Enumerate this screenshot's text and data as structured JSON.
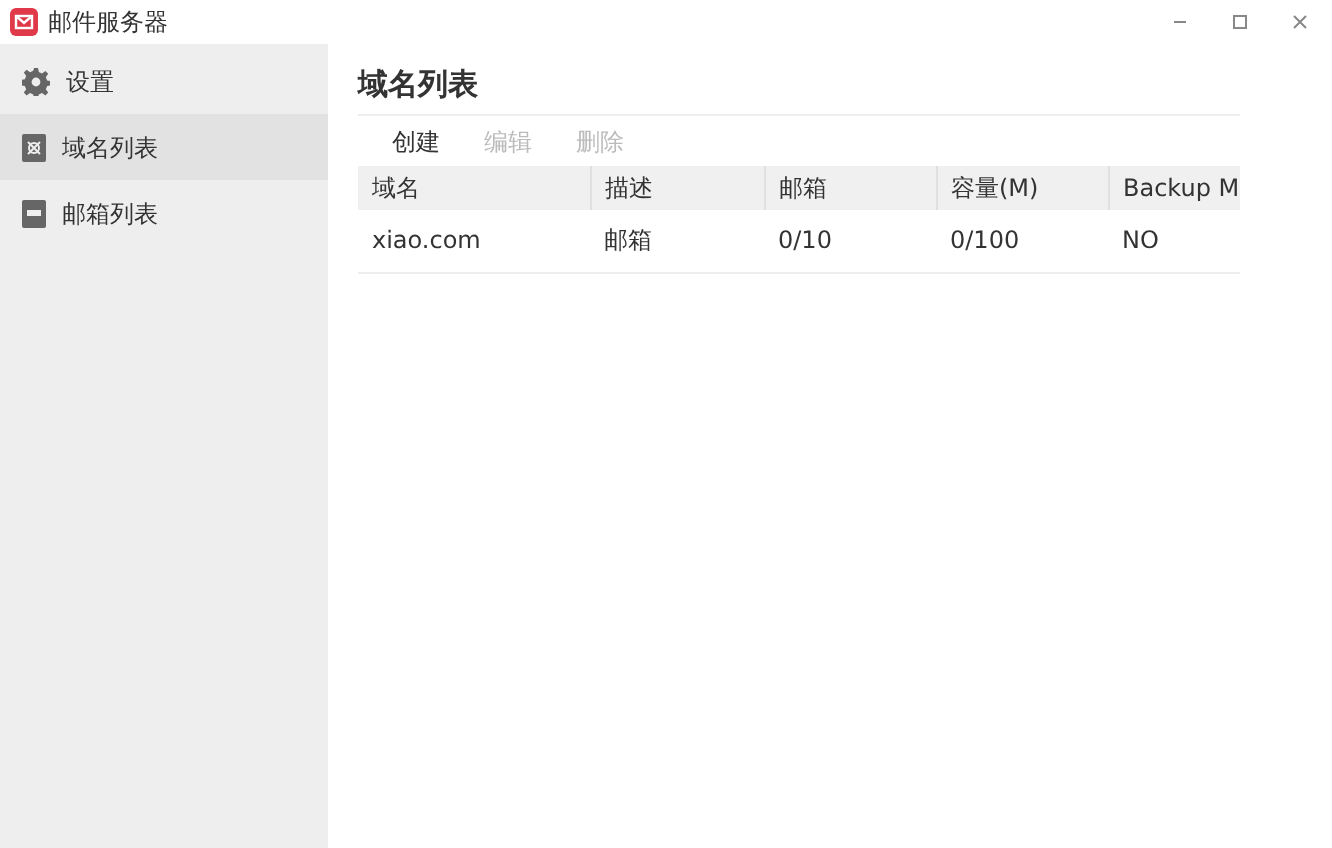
{
  "window": {
    "title": "邮件服务器"
  },
  "sidebar": {
    "items": [
      {
        "label": "设置",
        "selected": false
      },
      {
        "label": "域名列表",
        "selected": true
      },
      {
        "label": "邮箱列表",
        "selected": false
      }
    ]
  },
  "page": {
    "title": "域名列表"
  },
  "toolbar": [
    {
      "label": "创建",
      "disabled": false
    },
    {
      "label": "编辑",
      "disabled": true
    },
    {
      "label": "删除",
      "disabled": true
    }
  ],
  "table": {
    "columns": [
      "域名",
      "描述",
      "邮箱",
      "容量(M)",
      "Backup M"
    ],
    "rows": [
      [
        "xiao.com",
        "邮箱",
        "0/10",
        "0/100",
        "NO"
      ]
    ]
  }
}
